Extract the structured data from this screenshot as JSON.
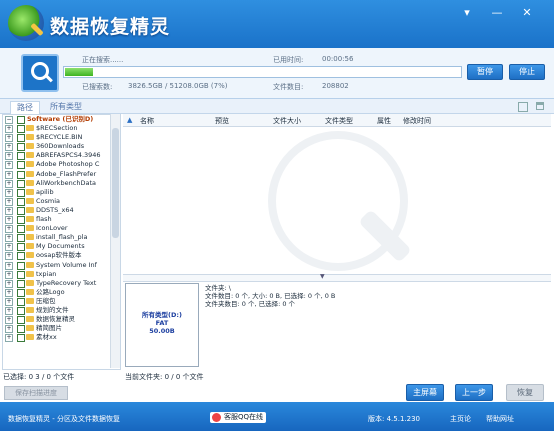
{
  "app": {
    "title": "数据恢复精灵"
  },
  "window_controls": {
    "menu": "▾",
    "minimize": "—",
    "close": "✕"
  },
  "scan": {
    "scanning_label": "正在搜索......",
    "elapsed_label": "已用时间:",
    "elapsed_value": "00:00:56",
    "searched_label": "已搜索数:",
    "searched_value": "3826.5GB / 51208.0GB (7%)",
    "found_label": "文件数目:",
    "found_value": "208802",
    "progress_percent": 7,
    "pause_label": "暂停",
    "stop_label": "停止"
  },
  "tabs": [
    {
      "label": "路径"
    },
    {
      "label": "所有类型"
    }
  ],
  "tree": {
    "root": "Software (已识别D)",
    "items": [
      "$RECSection",
      "$RECYCLE.BIN",
      "360Downloads",
      "ABREFASPCS4.3946",
      "Adobe Photoshop C",
      "Adobe_FlashPrefer",
      "AliWorkbenchData",
      "apilib",
      "Cosmia",
      "DDSTS_x64",
      "flash",
      "IconLover",
      "install_flash_pla",
      "My Documents",
      "oosap软件版本",
      "System Volume Inf",
      "txpian",
      "TypeRecovery Text",
      "公路Logo",
      "压缩包",
      "规划的文件",
      "数据恢复精灵",
      "精简图片",
      "素材xx"
    ]
  },
  "file_table": {
    "columns": [
      "名称",
      "预览",
      "文件大小",
      "文件类型",
      "属性",
      "修改时间"
    ]
  },
  "preview": {
    "line1": "所有类型(D:)",
    "line2": "FAT",
    "line3": "50.00B"
  },
  "info": {
    "line1": "文件夹: \\",
    "line2": "文件数目: 0 个, 大小: 0 B, 已选择: 0 个, 0 B",
    "line3": "文件夹数目: 0 个, 已选择: 0 个"
  },
  "status": {
    "selected": "已选择: 0 3 / 0 个文件",
    "current_folder": "当前文件夹: 0 / 0 个文件"
  },
  "buttons": {
    "save_scan": "保存扫描进度",
    "home": "主屏幕",
    "prev": "上一步",
    "recover": "恢复"
  },
  "footer": {
    "left": "数据恢复精灵 - 分区及文件数据恢复",
    "qq": "客服QQ在线",
    "version": "版本: 4.5.1.230",
    "site": "主页论",
    "help": "帮助网址"
  }
}
